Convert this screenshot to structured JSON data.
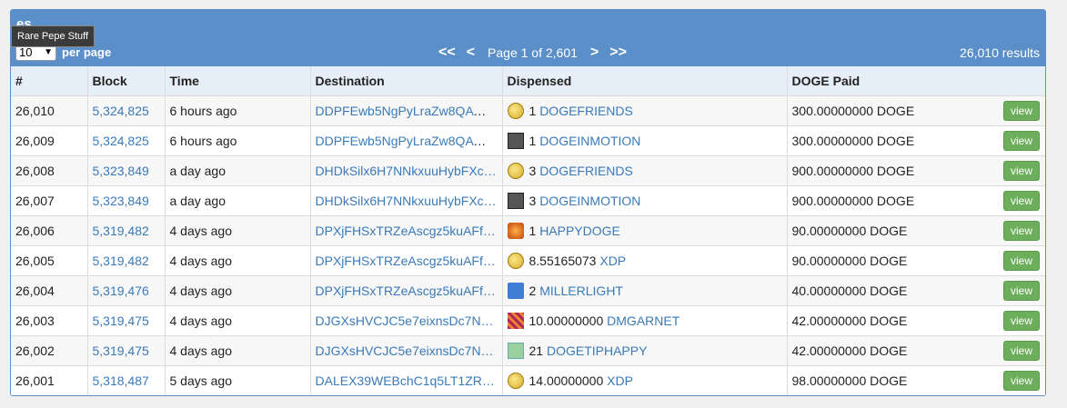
{
  "header": {
    "title": "es",
    "tooltip": "Rare Pepe Stuff",
    "per_page_value": "10",
    "per_page_label": "per page",
    "first_label": "<<",
    "prev_label": "<",
    "page_text": "Page 1 of 2,601",
    "next_label": ">",
    "last_label": ">>",
    "results_text": "26,010 results"
  },
  "table": {
    "columns": [
      "#",
      "Block",
      "Time",
      "Destination",
      "Dispensed",
      "DOGE Paid"
    ],
    "view_label": "view",
    "rows": [
      {
        "num": "26,010",
        "block": "5,324,825",
        "time": "6 hours ago",
        "dest": "DDPFEwb5NgPyLraZw8QAW…",
        "amount": "1",
        "token": "DOGEFRIENDS",
        "icon": "coin",
        "paid": "300.00000000 DOGE"
      },
      {
        "num": "26,009",
        "block": "5,324,825",
        "time": "6 hours ago",
        "dest": "DDPFEwb5NgPyLraZw8QAW…",
        "amount": "1",
        "token": "DOGEINMOTION",
        "icon": "motion",
        "paid": "300.00000000 DOGE"
      },
      {
        "num": "26,008",
        "block": "5,323,849",
        "time": "a day ago",
        "dest": "DHDkSilx6H7NNkxuuHybFXc…",
        "amount": "3",
        "token": "DOGEFRIENDS",
        "icon": "coin",
        "paid": "900.00000000 DOGE"
      },
      {
        "num": "26,007",
        "block": "5,323,849",
        "time": "a day ago",
        "dest": "DHDkSilx6H7NNkxuuHybFXc…",
        "amount": "3",
        "token": "DOGEINMOTION",
        "icon": "motion",
        "paid": "900.00000000 DOGE"
      },
      {
        "num": "26,006",
        "block": "5,319,482",
        "time": "4 days ago",
        "dest": "DPXjFHSxTRZeAscgz5kuAFf…",
        "amount": "1",
        "token": "HAPPYDOGE",
        "icon": "happy",
        "paid": "90.00000000 DOGE"
      },
      {
        "num": "26,005",
        "block": "5,319,482",
        "time": "4 days ago",
        "dest": "DPXjFHSxTRZeAscgz5kuAFf…",
        "amount": "8.55165073",
        "token": "XDP",
        "icon": "coin",
        "paid": "90.00000000 DOGE"
      },
      {
        "num": "26,004",
        "block": "5,319,476",
        "time": "4 days ago",
        "dest": "DPXjFHSxTRZeAscgz5kuAFf…",
        "amount": "2",
        "token": "MILLERLIGHT",
        "icon": "miller",
        "paid": "40.00000000 DOGE"
      },
      {
        "num": "26,003",
        "block": "5,319,475",
        "time": "4 days ago",
        "dest": "DJGXsHVCJC5e7eixnsDc7N…",
        "amount": "10.00000000",
        "token": "DMGARNET",
        "icon": "garnet",
        "paid": "42.00000000 DOGE"
      },
      {
        "num": "26,002",
        "block": "5,319,475",
        "time": "4 days ago",
        "dest": "DJGXsHVCJC5e7eixnsDc7N…",
        "amount": "21",
        "token": "DOGETIPHAPPY",
        "icon": "tip",
        "paid": "42.00000000 DOGE"
      },
      {
        "num": "26,001",
        "block": "5,318,487",
        "time": "5 days ago",
        "dest": "DALEX39WEBchC1q5LT1ZR…",
        "amount": "14.00000000",
        "token": "XDP",
        "icon": "coin",
        "paid": "98.00000000 DOGE"
      }
    ]
  }
}
